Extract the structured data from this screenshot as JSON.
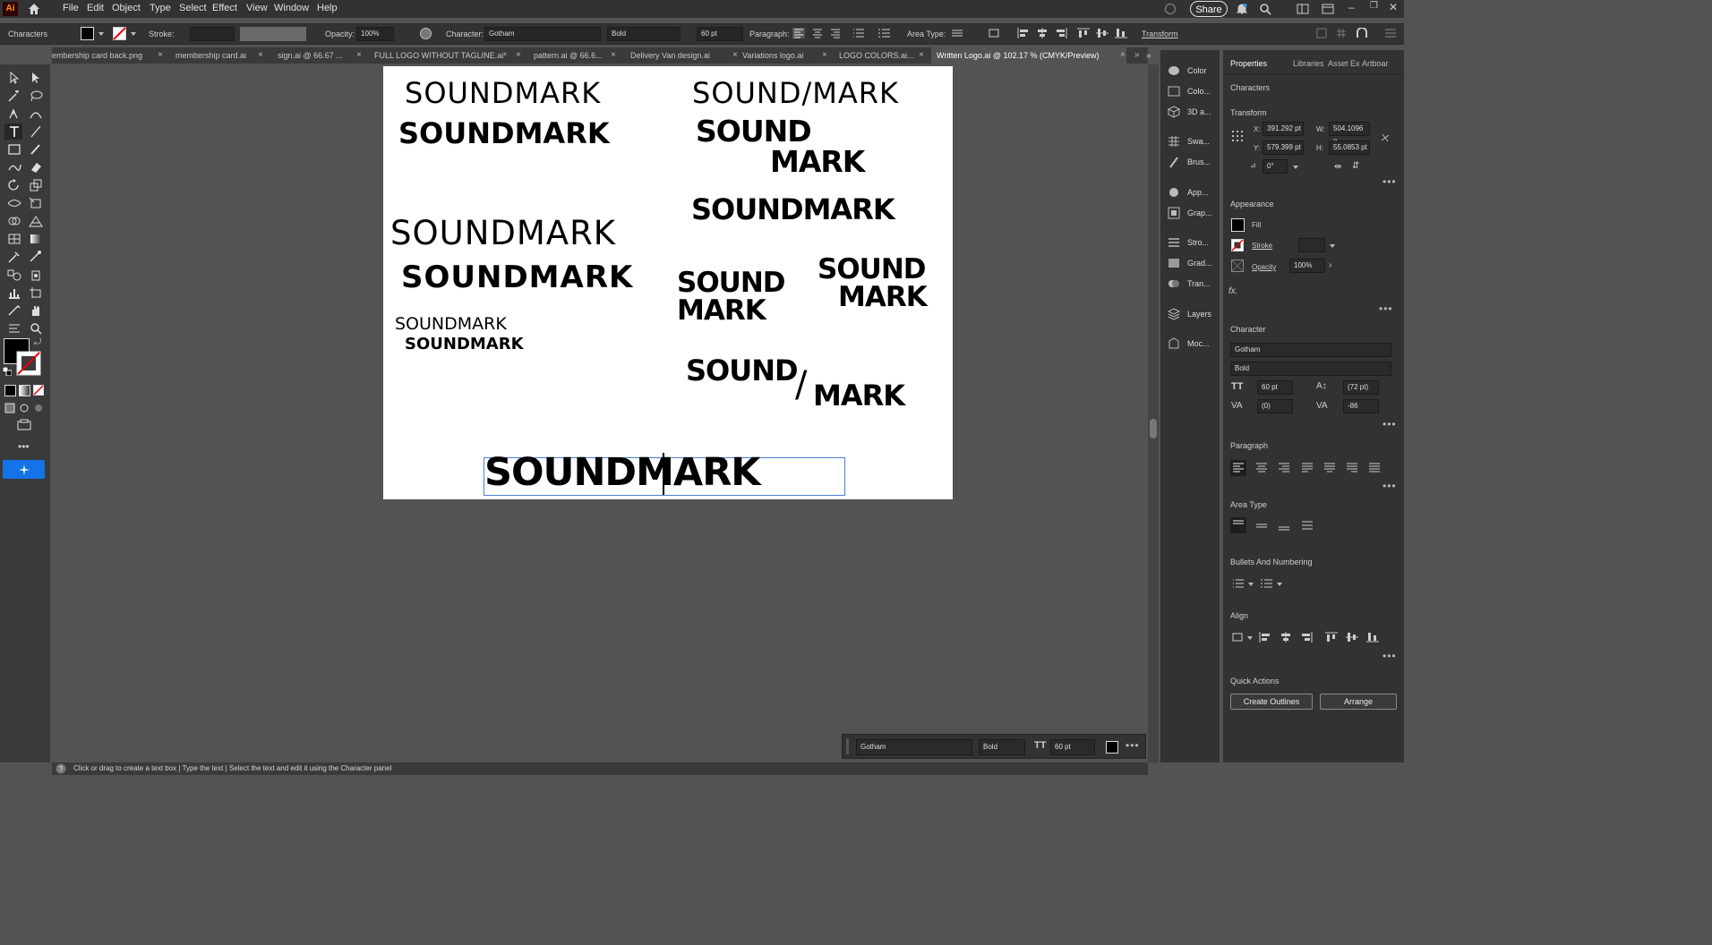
{
  "menubar": {
    "app_logo": "Ai",
    "items": [
      "File",
      "Edit",
      "Object",
      "Type",
      "Select",
      "Effect",
      "View",
      "Window",
      "Help"
    ],
    "share_label": "Share"
  },
  "controlbar": {
    "context": "Characters",
    "stroke_label": "Stroke:",
    "opacity_label": "Opacity:",
    "opacity_value": "100%",
    "character_label": "Character:",
    "font_family": "Gotham",
    "font_style": "Bold",
    "font_size": "60 pt",
    "paragraph_label": "Paragraph:",
    "area_type_label": "Area Type:",
    "transform_label": "Transform"
  },
  "tabs": [
    {
      "label": "embership card back.png"
    },
    {
      "label": "membership card.ai"
    },
    {
      "label": "sign.ai @ 66.67 ..."
    },
    {
      "label": "FULL LOGO WITHOUT TAGLINE.ai*"
    },
    {
      "label": "pattern.ai @ 66.6..."
    },
    {
      "label": "Delivery Van design.ai"
    },
    {
      "label": "Variations logo.ai"
    },
    {
      "label": "LOGO COLORS.ai..."
    },
    {
      "label": "Written Logo.ai @ 102.17 % (CMYK/Preview)"
    }
  ],
  "artboard": {
    "logo_1": "SOUNDMARK",
    "logo_2": "SOUNDMARK",
    "logo_3": "SOUNDMARK",
    "logo_4": "SOUNDMARK",
    "logo_5a": "SOUNDMARK",
    "logo_5b": "SOUNDMARK",
    "logo_slash": "SOUND/MARK",
    "logo_stack_a1": "SOUND",
    "logo_stack_a2": "MARK",
    "logo_6": "SOUNDMARK",
    "logo_stack_b1": "SOUND",
    "logo_stack_b2": "MARK",
    "logo_stack_c1": "SOUND",
    "logo_stack_c2": "MARK",
    "logo_slash2_a": "SOUND",
    "logo_slash2_s": "/",
    "logo_slash2_b": "MARK",
    "editing_text": "SOUNDMARK"
  },
  "iconstrip": {
    "items": [
      "Color",
      "Colo...",
      "3D a...",
      "Swa...",
      "Brus...",
      "App...",
      "Grap...",
      "Stro...",
      "Grad...",
      "Tran...",
      "Layers",
      "Moc..."
    ]
  },
  "properties": {
    "tabs": [
      "Properties",
      "Libraries",
      "Asset Ex",
      "Artboar"
    ],
    "characters_title": "Characters",
    "transform_title": "Transform",
    "x_label": "X:",
    "x_value": "391.292 pt",
    "y_label": "Y:",
    "y_value": "579.399 pt",
    "w_label": "W:",
    "w_value": "504.1096 p",
    "h_label": "H:",
    "h_value": "55.0853 pt",
    "rotate_value": "0°",
    "appearance_title": "Appearance",
    "fill_label": "Fill",
    "stroke_label": "Stroke",
    "opacity_label": "Opacity",
    "opacity_value": "100%",
    "fx_label": "fx.",
    "character_title": "Character",
    "font_family": "Gotham",
    "font_style": "Bold",
    "font_size": "60 pt",
    "leading": "(72 pt)",
    "kerning": "(0)",
    "tracking": "-86",
    "paragraph_title": "Paragraph",
    "area_type_title": "Area Type",
    "bullets_title": "Bullets And Numbering",
    "align_title": "Align",
    "quick_actions_title": "Quick Actions",
    "create_outlines": "Create Outlines",
    "arrange": "Arrange"
  },
  "ctxbar": {
    "font_family": "Gotham",
    "font_style": "Bold",
    "font_size": "60 pt"
  },
  "statusbar": {
    "hint": "Click or drag to create a text box  |  Type the text  |  Select the text and edit it using the Character panel"
  },
  "colors": {
    "accent_blue": "#1473e6",
    "text_frame": "#4a7fd6"
  }
}
